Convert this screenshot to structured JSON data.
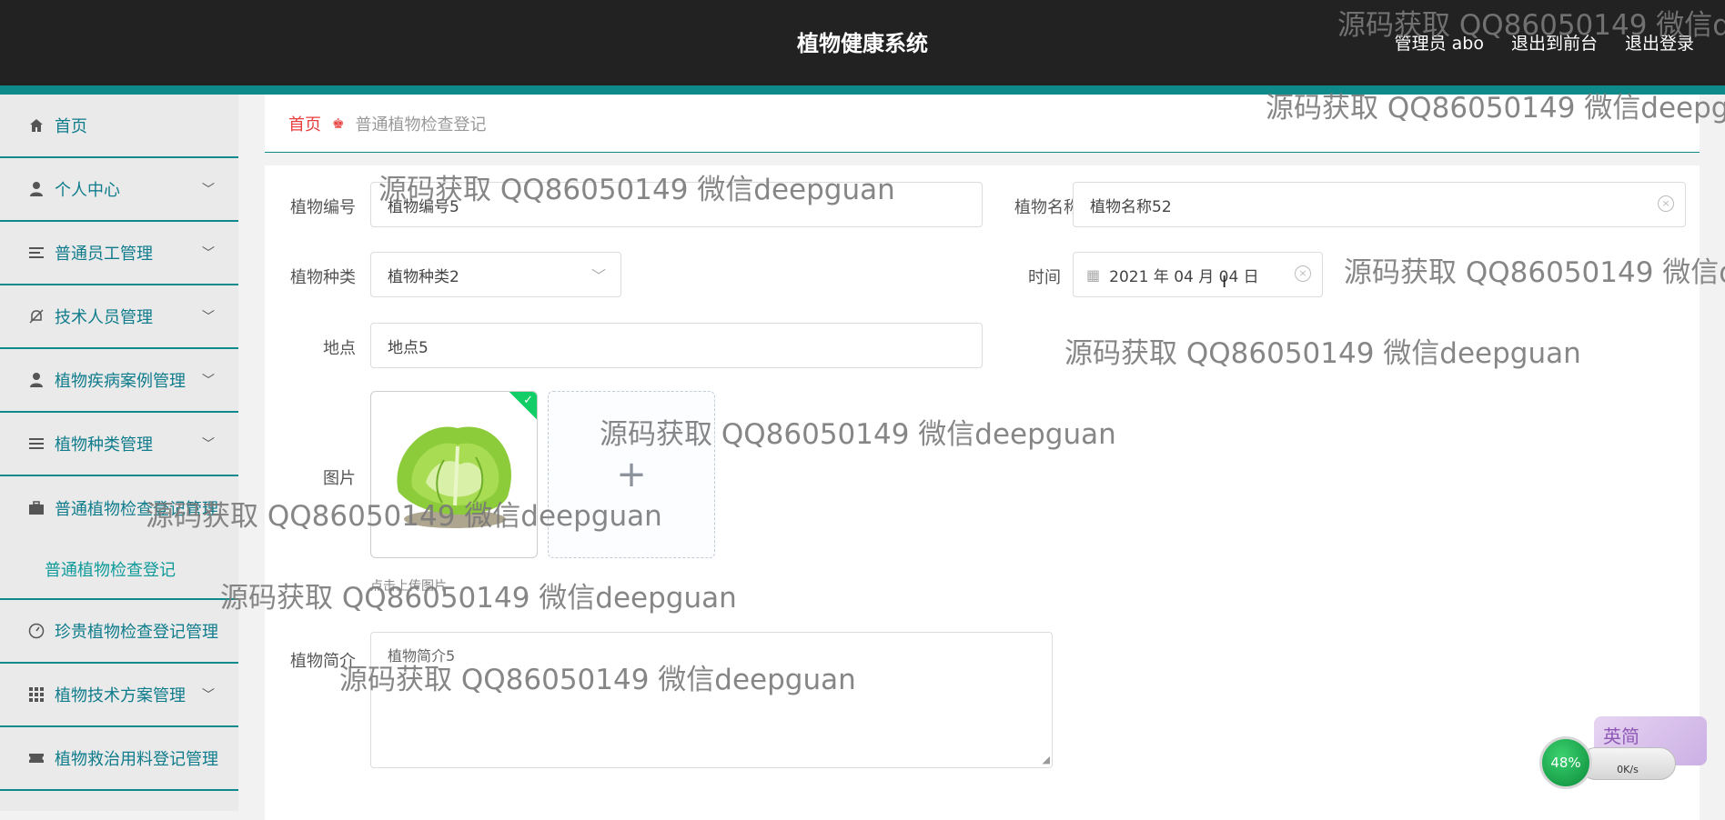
{
  "header": {
    "title": "植物健康系统",
    "admin_label": "管理员 abo",
    "front_link": "退出到前台",
    "logout_link": "退出登录"
  },
  "sidebar": {
    "items": [
      {
        "label": "首页",
        "icon": "home-icon"
      },
      {
        "label": "个人中心",
        "icon": "user-icon"
      },
      {
        "label": "普通员工管理",
        "icon": "list-icon"
      },
      {
        "label": "技术人员管理",
        "icon": "bell-off-icon"
      },
      {
        "label": "植物疾病案例管理",
        "icon": "user-icon"
      },
      {
        "label": "植物种类管理",
        "icon": "menu-icon"
      },
      {
        "label": "普通植物检查登记管理",
        "icon": "briefcase-icon"
      },
      {
        "label": "珍贵植物检查登记管理",
        "icon": "gauge-icon"
      },
      {
        "label": "植物技术方案管理",
        "icon": "grid-icon"
      },
      {
        "label": "植物救治用料登记管理",
        "icon": "ticket-icon"
      }
    ],
    "sub_item": "普通植物检查登记"
  },
  "breadcrumb": {
    "home": "首页",
    "current": "普通植物检查登记"
  },
  "form": {
    "plant_no_label": "植物编号",
    "plant_no_value": "植物编号5",
    "plant_name_label": "植物名称",
    "plant_name_value": "植物名称52",
    "plant_type_label": "植物种类",
    "plant_type_value": "植物种类2",
    "time_label": "时间",
    "time_value": "2021 年 04 月 04 日",
    "location_label": "地点",
    "location_value": "地点5",
    "image_label": "图片",
    "upload_tip": "点击上传图片",
    "intro_label": "植物简介",
    "intro_value": "植物简介5"
  },
  "watermark": "源码获取 QQ86050149 微信deepguan",
  "widget": {
    "percent": "48%",
    "speed": "0K/s",
    "ime": "英简"
  },
  "colors": {
    "header_bg": "#222222",
    "accent": "#0f8a8a",
    "breadcrumb_home": "#e83e3e",
    "success": "#13ce66"
  }
}
